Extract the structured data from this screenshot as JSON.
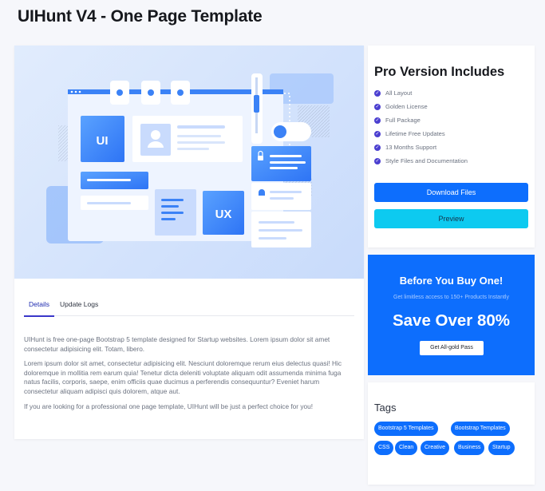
{
  "page": {
    "title": "UIHunt V4 - One Page Template"
  },
  "hero": {
    "ui_label": "UI",
    "ux_label": "UX"
  },
  "tabs": [
    {
      "label": "Details",
      "active": true
    },
    {
      "label": "Update Logs",
      "active": false
    }
  ],
  "description": [
    "UIHunt is free one-page Bootstrap 5 template designed for Startup websites. Lorem ipsum dolor sit amet consectetur adipisicing elit. Totam, libero.",
    "Lorem ipsum dolor sit amet, consectetur adipisicing elit. Nesciunt doloremque rerum eius delectus quasi! Hic doloremque in mollitia rem earum quia! Tenetur dicta deleniti voluptate aliquam odit assumenda minima fuga natus facilis, corporis, saepe, enim officiis quae ducimus a perferendis consequuntur? Eveniet harum consectetur aliquam adipisci quis dolorem, atque aut.",
    "If you are looking for a professional one page template, UIHunt will be just a perfect choice for you!"
  ],
  "pro": {
    "title": "Pro Version Includes",
    "items": [
      "All Layout",
      "Golden License",
      "Full Package",
      "Lifetime Free Updates",
      "13 Months Support",
      "Style Files and Documentation"
    ],
    "download_label": "Download Files",
    "preview_label": "Preview"
  },
  "promo": {
    "title": "Before You Buy One!",
    "subtitle": "Get limitless access to 150+ Products Instantly",
    "headline": "Save Over 80%",
    "button_label": "Get All-gold Pass"
  },
  "tags": {
    "title": "Tags",
    "items": [
      "Bootstrap 5 Templates",
      "Bootstrap Templates",
      "CSS",
      "Clean",
      "Creative",
      "Business",
      "Startup"
    ]
  },
  "colors": {
    "primary": "#0d6efd",
    "info": "#0dcaf0",
    "accent": "#4b3fd0"
  }
}
